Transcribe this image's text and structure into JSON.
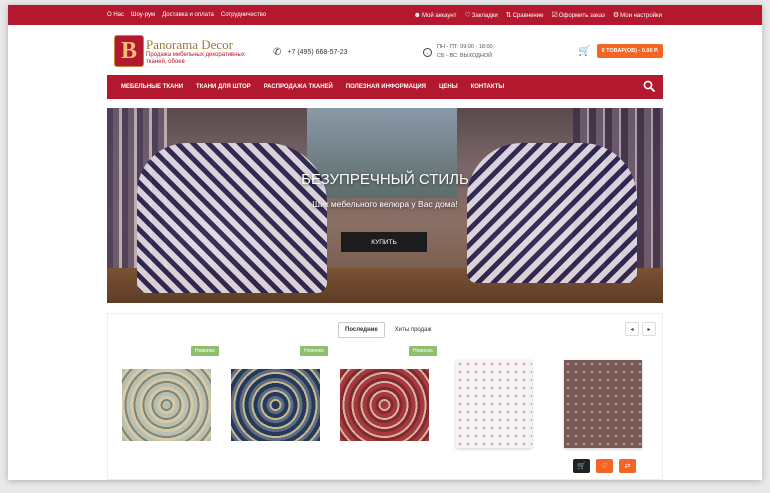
{
  "topbar": {
    "left_links": [
      "О Нас",
      "Шоу-рум",
      "Доставка и оплата",
      "Сотрудничество"
    ],
    "right_links": [
      {
        "icon": "user-icon",
        "label": "Мой аккаунт"
      },
      {
        "icon": "heart-icon",
        "label": "Закладки"
      },
      {
        "icon": "compare-icon",
        "label": "Сравнение"
      },
      {
        "icon": "checkout-icon",
        "label": "Оформить заказ"
      },
      {
        "icon": "gear-icon",
        "label": "Мои настройки"
      }
    ]
  },
  "header": {
    "logo_letter": "B",
    "brand": "Panorama Decor",
    "tagline": "Продажа мебельных декоративных тканей, обоев",
    "phone": "+7 (495) 668-57-23",
    "hours_line1": "ПН - ПТ: 09:00 - 18:00;",
    "hours_line2": "СБ - ВС: ВЫХОДНОЙ",
    "cart_label": "0 ТОВАР(ОВ) - 0.00 Р."
  },
  "nav": {
    "items": [
      "МЕБЕЛЬНЫЕ ТКАНИ",
      "ТКАНИ ДЛЯ ШТОР",
      "РАСПРОДАЖА ТКАНЕЙ",
      "ПОЛЕЗНАЯ ИНФОРМАЦИЯ",
      "ЦЕНЫ",
      "КОНТАКТЫ"
    ]
  },
  "hero": {
    "title": "БЕЗУПРЕЧНЫЙ СТИЛЬ",
    "subtitle": "Шик мебельного велюра у Вас дома!",
    "button": "КУПИТЬ"
  },
  "products": {
    "tabs": [
      "Последние",
      "Хиты продаж"
    ],
    "prev": "◂",
    "next": "▸",
    "badge": "Новинка",
    "items": [
      {
        "badge": "Новинка"
      },
      {
        "badge": "Новинка"
      },
      {
        "badge": "Новинка"
      },
      {
        "badge": ""
      },
      {
        "badge": ""
      }
    ]
  },
  "colors": {
    "brand_red": "#b4182e",
    "accent_orange": "#f26522",
    "badge_green": "#8fbf6c"
  }
}
